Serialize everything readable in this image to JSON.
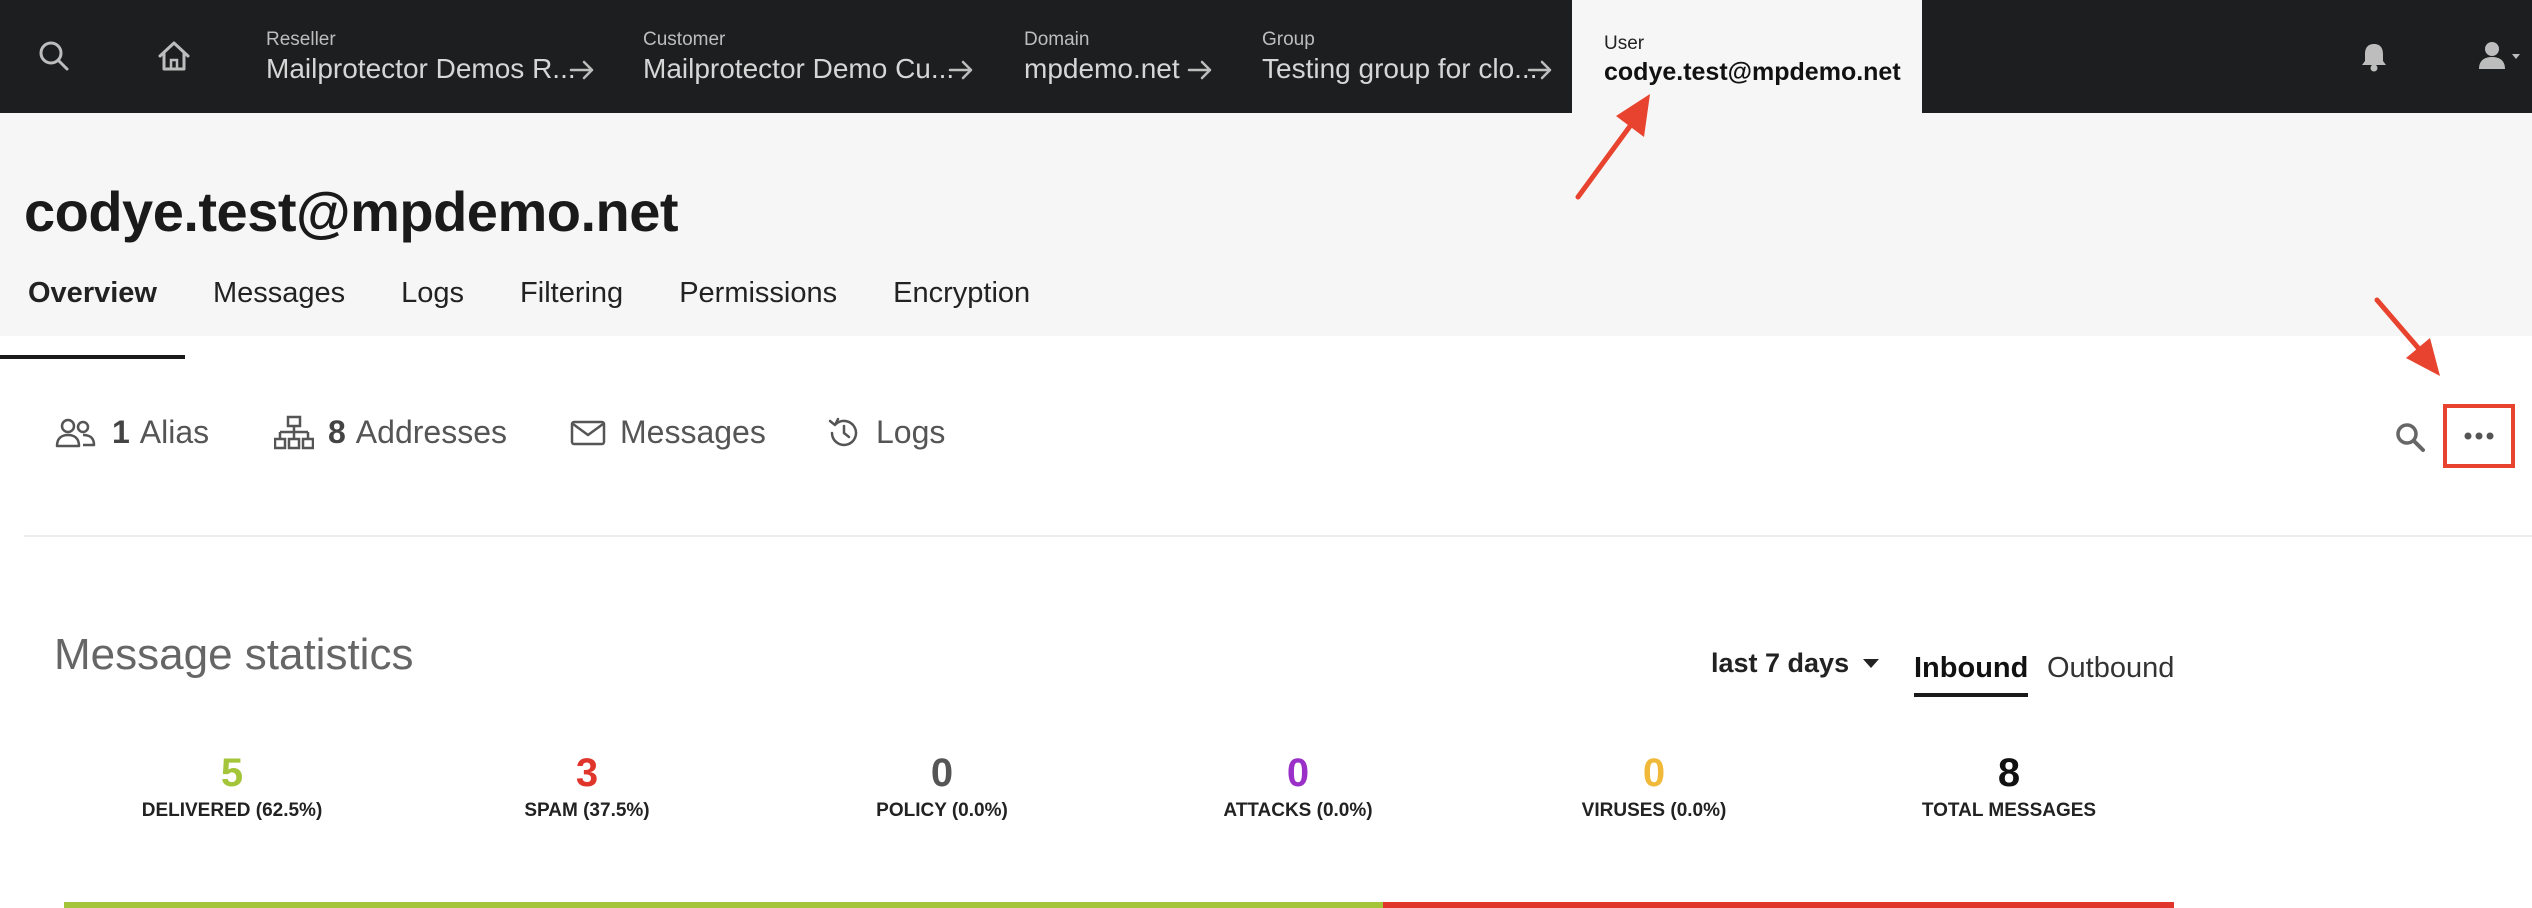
{
  "nav": {
    "breadcrumbs": [
      {
        "level": "Reseller",
        "value": "Mailprotector Demos R..."
      },
      {
        "level": "Customer",
        "value": "Mailprotector Demo Cu..."
      },
      {
        "level": "Domain",
        "value": "mpdemo.net"
      },
      {
        "level": "Group",
        "value": "Testing group for clo..."
      }
    ],
    "active": {
      "level": "User",
      "value": "codye.test@mpdemo.net"
    },
    "icons": [
      "search-icon",
      "home-icon",
      "bell-icon",
      "user-icon"
    ]
  },
  "page": {
    "title": "codye.test@mpdemo.net",
    "tabs": [
      "Overview",
      "Messages",
      "Logs",
      "Filtering",
      "Permissions",
      "Encryption"
    ],
    "active_tab": "Overview"
  },
  "subbar": {
    "alias_count": "1",
    "alias_label": "Alias",
    "addresses_count": "8",
    "addresses_label": "Addresses",
    "messages_label": "Messages",
    "logs_label": "Logs"
  },
  "stats": {
    "title": "Message statistics",
    "period": "last 7 days",
    "directions": [
      "Inbound",
      "Outbound"
    ],
    "active_direction": "Inbound",
    "items": [
      {
        "value": "5",
        "label": "DELIVERED (62.5%)",
        "color": "#a4c43a"
      },
      {
        "value": "3",
        "label": "SPAM (37.5%)",
        "color": "#e0352b"
      },
      {
        "value": "0",
        "label": "POLICY (0.0%)",
        "color": "#555555"
      },
      {
        "value": "0",
        "label": "ATTACKS (0.0%)",
        "color": "#9b30c9"
      },
      {
        "value": "0",
        "label": "VIRUSES (0.0%)",
        "color": "#f0b93a"
      },
      {
        "value": "8",
        "label": "TOTAL MESSAGES",
        "color": "#111111"
      }
    ],
    "bar_fractions": {
      "delivered": 0.625,
      "spam": 0.375
    }
  },
  "colors": {
    "nav_bg": "#1d1e1f",
    "header_bg": "#f6f6f6",
    "annotation": "#e8432f"
  }
}
